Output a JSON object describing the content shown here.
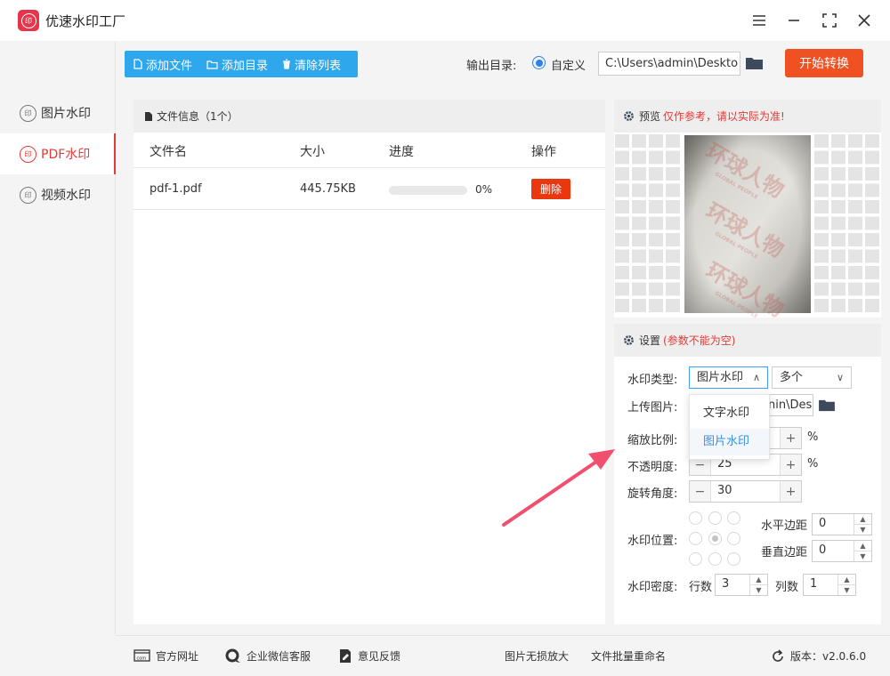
{
  "window": {
    "title": "优速水印工厂",
    "logo_glyph": "印"
  },
  "sidebar": {
    "items": [
      {
        "label": "图片水印",
        "icon_glyph": "印"
      },
      {
        "label": "PDF水印",
        "icon_glyph": "印",
        "active": true
      },
      {
        "label": "视频水印",
        "icon_glyph": "印"
      }
    ]
  },
  "toolbar": {
    "add_file": "添加文件",
    "add_dir": "添加目录",
    "clear_list": "清除列表",
    "output_label": "输出目录:",
    "custom_label": "自定义",
    "output_path": "C:\\Users\\admin\\Deskto",
    "start_button": "开始转换"
  },
  "file_panel": {
    "header": "文件信息（1个）",
    "columns": [
      "文件名",
      "大小",
      "进度",
      "操作"
    ],
    "rows": [
      {
        "name": "pdf-1.pdf",
        "size": "445.75KB",
        "progress_text": "0%",
        "progress": 0,
        "action": "删除"
      }
    ]
  },
  "preview": {
    "title": "预览",
    "note": "仅作参考，请以实际为准!",
    "watermark_text": "环球人物",
    "watermark_sub": "GLOBAL PEOPLE"
  },
  "settings": {
    "title": "设置",
    "note": "(参数不能为空)",
    "wm_type_label": "水印类型:",
    "wm_type_value": "图片水印",
    "mode_value": "多个",
    "dropdown_options": [
      "文字水印",
      "图片水印"
    ],
    "upload_label": "上传图片:",
    "upload_value": "nin\\Des",
    "scale_label": "缩放比例:",
    "opacity_label": "不透明度:",
    "opacity_value": "25",
    "rotate_label": "旋转角度:",
    "rotate_value": "30",
    "percent": "%",
    "position_label": "水印位置:",
    "h_margin_label": "水平边距",
    "h_margin_value": "0",
    "v_margin_label": "垂直边距",
    "v_margin_value": "0",
    "density_label": "水印密度:",
    "rows_label": "行数",
    "rows_value": "3",
    "cols_label": "列数",
    "cols_value": "1"
  },
  "footer": {
    "website": "官方网址",
    "wechat": "企业微信客服",
    "feedback": "意见反馈",
    "img_enlarge": "图片无损放大",
    "batch_rename": "文件批量重命名",
    "version_label": "版本：v2.0.6.0"
  },
  "colors": {
    "accent_blue": "#2ea7ec",
    "start_orange": "#f05123",
    "active_red": "#e53935",
    "arrow": "#f0506e"
  }
}
